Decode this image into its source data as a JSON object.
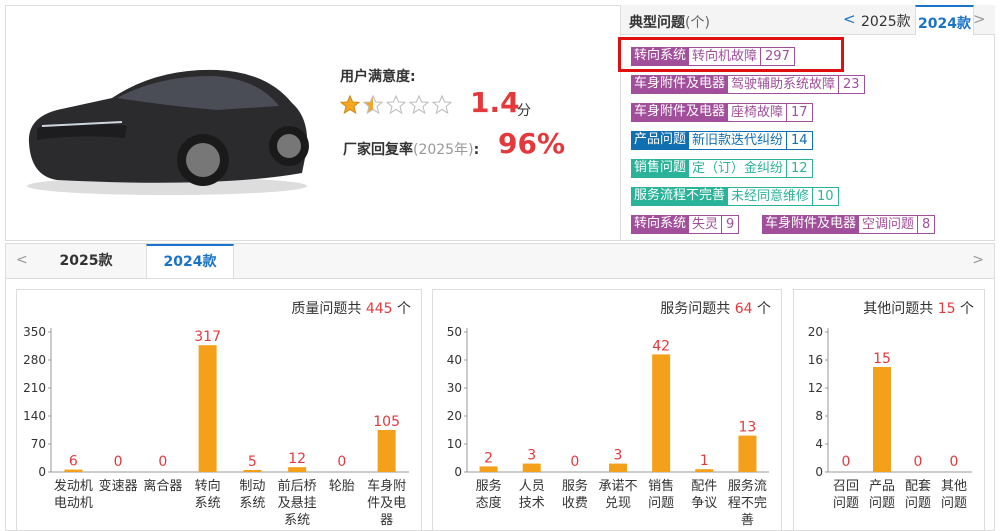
{
  "summary": {
    "satisfaction_label": "用户满意度:",
    "score": "1.4",
    "score_unit": "分",
    "rating": 1.4,
    "reply_label": "厂家回复率",
    "reply_year": "(2025年)",
    "reply_colon": ":",
    "reply_rate": "96%"
  },
  "issues": {
    "title": "典型问题",
    "title_unit": "(个)",
    "prev": "<",
    "year1": "2025款",
    "year2": "2024款",
    "next": ">",
    "tags": [
      {
        "cat": "转向系统",
        "desc": "转向机故障",
        "count": "297",
        "color": "purple"
      },
      {
        "cat": "车身附件及电器",
        "desc": "驾驶辅助系统故障",
        "count": "23",
        "color": "purple"
      },
      {
        "cat": "车身附件及电器",
        "desc": "座椅故障",
        "count": "17",
        "color": "purple"
      },
      {
        "cat": "产品问题",
        "desc": "新旧款迭代纠纷",
        "count": "14",
        "color": "blue"
      },
      {
        "cat": "销售问题",
        "desc": "定（订）金纠纷",
        "count": "12",
        "color": "green"
      },
      {
        "cat": "服务流程不完善",
        "desc": "未经同意维修",
        "count": "10",
        "color": "green"
      },
      {
        "cat": "转向系统",
        "desc": "失灵",
        "count": "9",
        "color": "purple"
      },
      {
        "cat": "车身附件及电器",
        "desc": "空调问题",
        "count": "8",
        "color": "purple"
      }
    ]
  },
  "tabs": {
    "prev": "<",
    "next": ">",
    "items": [
      "2025款",
      "2024款"
    ],
    "active": "2024款"
  },
  "panels": [
    {
      "pre": "质量问题共",
      "total": "445",
      "post": "个"
    },
    {
      "pre": "服务问题共",
      "total": "64",
      "post": "个"
    },
    {
      "pre": "其他问题共",
      "total": "15",
      "post": "个"
    }
  ],
  "chart_data": [
    {
      "type": "bar",
      "title": "质量问题共 445 个",
      "categories": [
        [
          "发动机",
          "电动机"
        ],
        [
          "变速器"
        ],
        [
          "离合器"
        ],
        [
          "转向",
          "系统"
        ],
        [
          "制动",
          "系统"
        ],
        [
          "前后桥",
          "及悬挂",
          "系统"
        ],
        [
          "轮胎"
        ],
        [
          "车身附",
          "件及电",
          "器"
        ]
      ],
      "values": [
        6,
        0,
        0,
        317,
        5,
        12,
        0,
        105
      ],
      "yticks": [
        0,
        70,
        140,
        210,
        280,
        350
      ],
      "ylim": [
        0,
        350
      ],
      "bar_color": "#f5a01a"
    },
    {
      "type": "bar",
      "title": "服务问题共 64 个",
      "categories": [
        [
          "服务",
          "态度"
        ],
        [
          "人员",
          "技术"
        ],
        [
          "服务",
          "收费"
        ],
        [
          "承诺不",
          "兑现"
        ],
        [
          "销售",
          "问题"
        ],
        [
          "配件",
          "争议"
        ],
        [
          "服务流",
          "程不完",
          "善"
        ]
      ],
      "values": [
        2,
        3,
        0,
        3,
        42,
        1,
        13
      ],
      "yticks": [
        0,
        10,
        20,
        30,
        40,
        50
      ],
      "ylim": [
        0,
        50
      ],
      "bar_color": "#f5a01a"
    },
    {
      "type": "bar",
      "title": "其他问题共 15 个",
      "categories": [
        [
          "召回",
          "问题"
        ],
        [
          "产品",
          "问题"
        ],
        [
          "配套",
          "问题"
        ],
        [
          "其他",
          "问题"
        ]
      ],
      "values": [
        0,
        15,
        0,
        0
      ],
      "yticks": [
        0,
        4,
        8,
        12,
        16,
        20
      ],
      "ylim": [
        0,
        20
      ],
      "bar_color": "#f5a01a"
    }
  ]
}
